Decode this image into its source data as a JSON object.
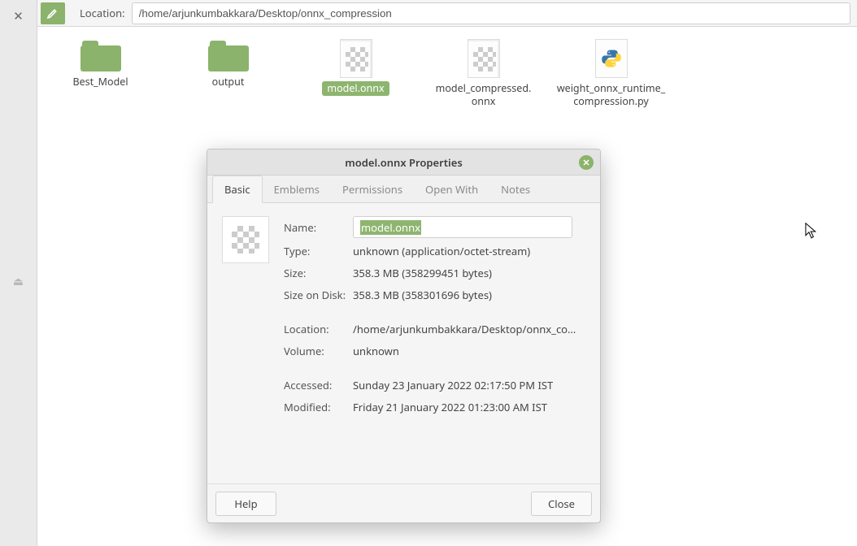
{
  "toolbar": {
    "location_label": "Location:",
    "path": "/home/arjunkumbakkara/Desktop/onnx_compression"
  },
  "files": [
    {
      "name": "Best_Model",
      "kind": "folder"
    },
    {
      "name": "output",
      "kind": "folder"
    },
    {
      "name": "model.onnx",
      "kind": "onnx",
      "selected": true
    },
    {
      "name": "model_compressed.\nonnx",
      "kind": "onnx"
    },
    {
      "name": "weight_onnx_runtime_\ncompression.py",
      "kind": "python"
    }
  ],
  "dialog": {
    "title": "model.onnx Properties",
    "tabs": [
      "Basic",
      "Emblems",
      "Permissions",
      "Open With",
      "Notes"
    ],
    "active_tab": 0,
    "name_label": "Name:",
    "name_value": "model.onnx",
    "type_label": "Type:",
    "type_value": "unknown (application/octet-stream)",
    "size_label": "Size:",
    "size_value": "358.3 MB (358299451 bytes)",
    "sizeondisk_label": "Size on Disk:",
    "sizeondisk_value": "358.3 MB (358301696 bytes)",
    "location_label": "Location:",
    "location_value": "/home/arjunkumbakkara/Desktop/onnx_compr...",
    "volume_label": "Volume:",
    "volume_value": "unknown",
    "accessed_label": "Accessed:",
    "accessed_value": "Sunday 23 January 2022 02:17:50 PM IST",
    "modified_label": "Modified:",
    "modified_value": "Friday 21 January 2022 01:23:00 AM IST",
    "help_label": "Help",
    "close_label": "Close"
  }
}
